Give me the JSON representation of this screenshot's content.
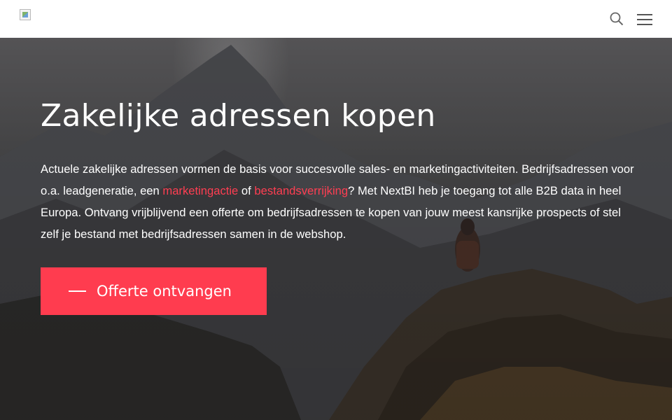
{
  "header": {
    "logo_icon": "broken-image-icon",
    "search_icon": "search-icon",
    "menu_icon": "hamburger-menu-icon"
  },
  "hero": {
    "title": "Zakelijke adressen kopen",
    "text_part1": "Actuele zakelijke adressen vormen de basis voor succesvolle sales- en marketingactiviteiten. Bedrijfsadressen voor o.a. leadgeneratie, een ",
    "link1": "marketingactie",
    "text_part2": " of ",
    "link2": "bestandsverrijking",
    "text_part3": "? Met NextBI heb je toegang tot alle B2B data in heel Europa. Ontvang vrijblijvend een offerte om bedrijfsadressen te kopen van jouw meest kansrijke prospects of stel zelf je bestand met bedrijfsadressen samen in de webshop.",
    "cta_label": "Offerte ontvangen",
    "link_color": "#ff3e52",
    "cta_color": "#ff3c4f"
  }
}
